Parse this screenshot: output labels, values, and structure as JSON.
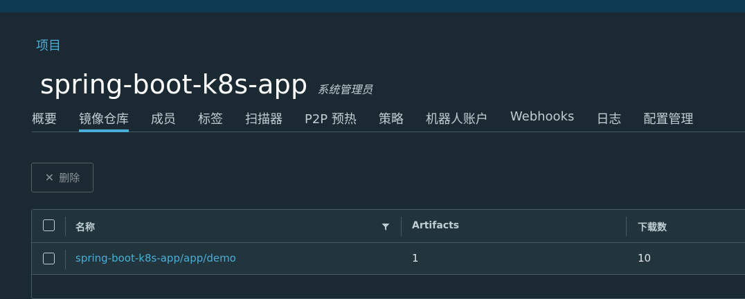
{
  "breadcrumb": "项目",
  "project": {
    "title": "spring-boot-k8s-app",
    "role": "系统管理员"
  },
  "tabs": [
    {
      "label": "概要",
      "active": false
    },
    {
      "label": "镜像仓库",
      "active": true
    },
    {
      "label": "成员",
      "active": false
    },
    {
      "label": "标签",
      "active": false
    },
    {
      "label": "扫描器",
      "active": false
    },
    {
      "label": "P2P 预热",
      "active": false
    },
    {
      "label": "策略",
      "active": false
    },
    {
      "label": "机器人账户",
      "active": false
    },
    {
      "label": "Webhooks",
      "active": false
    },
    {
      "label": "日志",
      "active": false
    },
    {
      "label": "配置管理",
      "active": false
    }
  ],
  "toolbar": {
    "delete_label": "删除"
  },
  "table": {
    "columns": [
      "名称",
      "Artifacts",
      "下载数"
    ],
    "rows": [
      {
        "name": "spring-boot-k8s-app/app/demo",
        "artifacts": "1",
        "pulls": "10"
      }
    ]
  },
  "colors": {
    "accent": "#49afd9",
    "background": "#1b2a32",
    "topbar": "#0e3a52"
  }
}
